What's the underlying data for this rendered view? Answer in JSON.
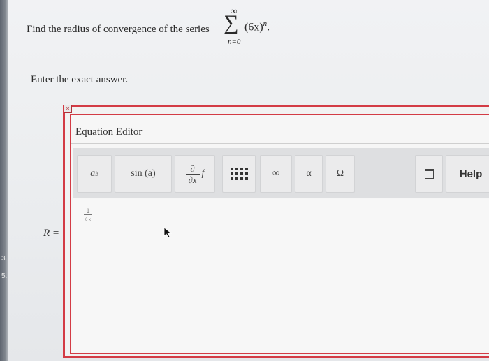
{
  "question": {
    "text": "Find the radius of convergence of the series",
    "sum_upper": "∞",
    "sum_symbol": "∑",
    "sum_lower": "n=0",
    "term": "(6x)",
    "term_exponent": "n",
    "term_end": "."
  },
  "instruction": "Enter the exact answer.",
  "answer_label": "R =",
  "editor": {
    "close_glyph": "×",
    "title": "Equation Editor",
    "toolbar": {
      "power_base": "a",
      "power_exp": "b",
      "sin_label": "sin (a)",
      "deriv_num": "∂",
      "deriv_den": "∂x",
      "deriv_f": "f",
      "infinity_label": "∞",
      "alpha_label": "α",
      "omega_label": "Ω",
      "help_label": "Help"
    },
    "input": {
      "numerator": "1",
      "denominator": "6 x"
    }
  },
  "left_strip_marks": [
    "3.",
    "5."
  ]
}
